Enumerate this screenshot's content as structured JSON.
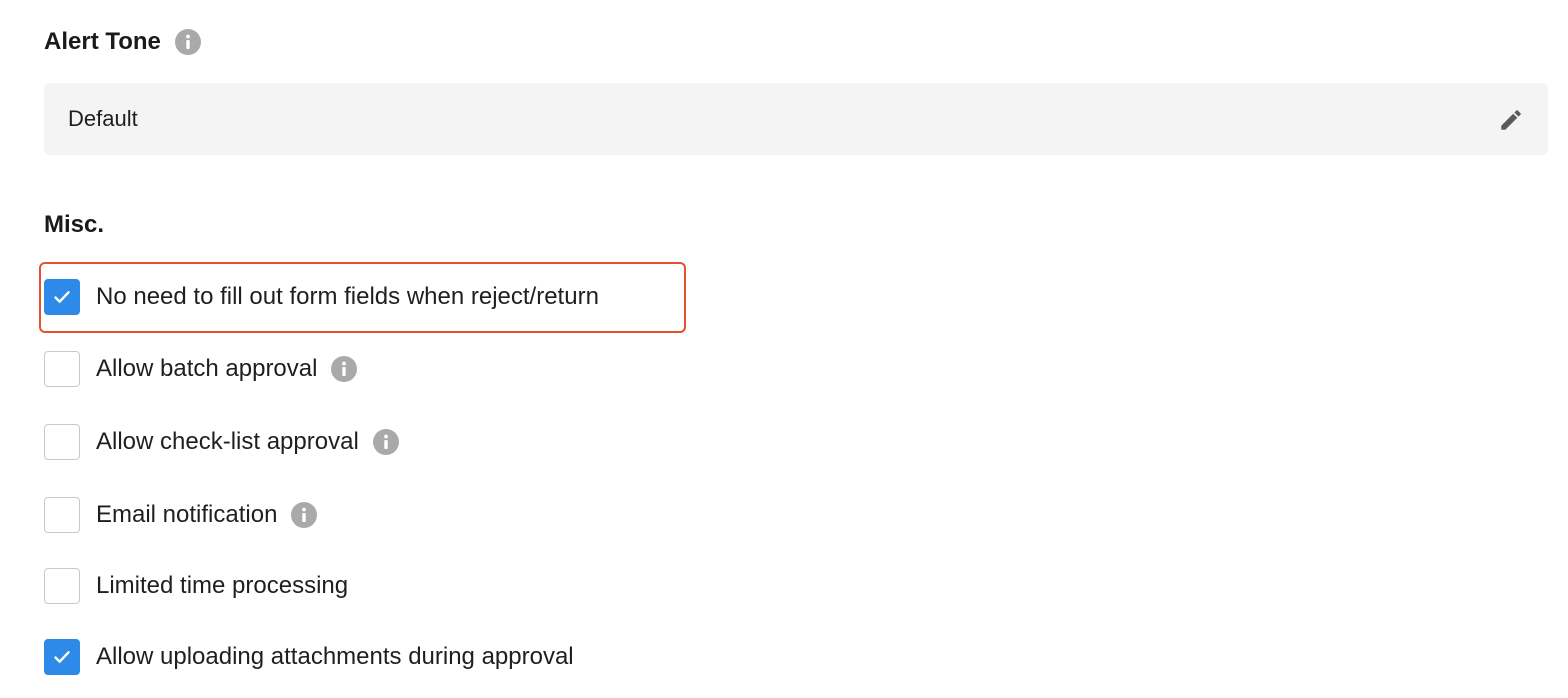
{
  "alert_tone": {
    "title": "Alert Tone",
    "info_icon": "info-icon",
    "value": "Default",
    "edit_icon": "pencil-icon"
  },
  "misc": {
    "title": "Misc.",
    "options": [
      {
        "label": "No need to fill out form fields when reject/return",
        "checked": true,
        "info": false
      },
      {
        "label": "Allow batch approval",
        "checked": false,
        "info": true
      },
      {
        "label": "Allow check-list approval",
        "checked": false,
        "info": true
      },
      {
        "label": "Email notification",
        "checked": false,
        "info": true
      },
      {
        "label": "Limited time processing",
        "checked": false,
        "info": false
      },
      {
        "label": "Allow uploading attachments during approval",
        "checked": true,
        "info": false
      }
    ]
  },
  "colors": {
    "checkbox_checked": "#2d8ae8",
    "highlight_border": "#e5502f",
    "info_icon": "#a9a9a9",
    "tone_box_bg": "#f4f4f4"
  }
}
